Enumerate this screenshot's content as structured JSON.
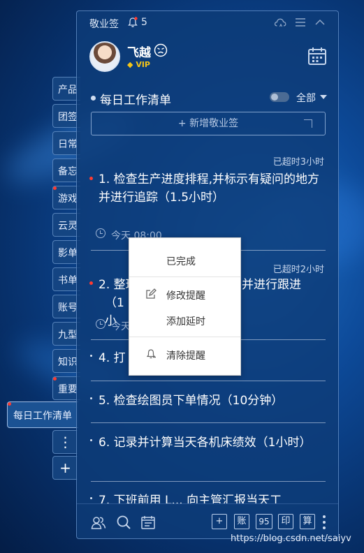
{
  "app": {
    "title": "敬业签",
    "notification_count": "5"
  },
  "user": {
    "name": "飞越",
    "badge": "VIP"
  },
  "sidebar": {
    "tabs": [
      {
        "label": "产品",
        "dot": false
      },
      {
        "label": "团签",
        "dot": false
      },
      {
        "label": "日常",
        "dot": false
      },
      {
        "label": "备忘",
        "dot": false
      },
      {
        "label": "游戏",
        "dot": true
      },
      {
        "label": "云灵",
        "dot": false
      },
      {
        "label": "影单",
        "dot": false
      },
      {
        "label": "书单",
        "dot": false
      },
      {
        "label": "账号",
        "dot": false
      },
      {
        "label": "九型",
        "dot": false
      },
      {
        "label": "知识",
        "dot": false
      },
      {
        "label": "重要",
        "dot": true
      }
    ],
    "active_tab": "每日工作清单",
    "more": "⋮",
    "add": "+"
  },
  "list": {
    "title": "每日工作清单",
    "filter": "全部",
    "add_button": "+ 新增敬业签"
  },
  "tasks": [
    {
      "overdue": "已超时3小时",
      "text": "1. 检查生产进度排程,并标示有疑问的地方并进行追踪（1.5小时）",
      "time": "今天 08:00",
      "dot": true
    },
    {
      "overdue": "已超时2小时",
      "text": "2. 整理",
      "text_tail": "并进行跟进",
      "text_line2": "（1小",
      "time": "今天",
      "dot": true
    },
    {
      "text": "4. 打",
      "dot": false
    },
    {
      "text": "5. 检查绘图员下单情况（10分钟）",
      "dot": false
    },
    {
      "text": "6. 记录并计算当天各机床绩效（1小时）",
      "dot": false
    },
    {
      "text": "7. 下班前用 L... 向主管汇报当天工",
      "dot": false
    }
  ],
  "context_menu": {
    "items": [
      {
        "label": "已完成",
        "icon": ""
      },
      {
        "label": "修改提醒",
        "icon": "edit-icon"
      },
      {
        "label": "添加延时",
        "icon": ""
      },
      {
        "label": "清除提醒",
        "icon": "bell-clear-icon"
      }
    ]
  },
  "bottombar": {
    "boxes": [
      "+",
      "账",
      "95",
      "印",
      "算"
    ]
  },
  "watermark": "https://blog.csdn.net/saiyv"
}
